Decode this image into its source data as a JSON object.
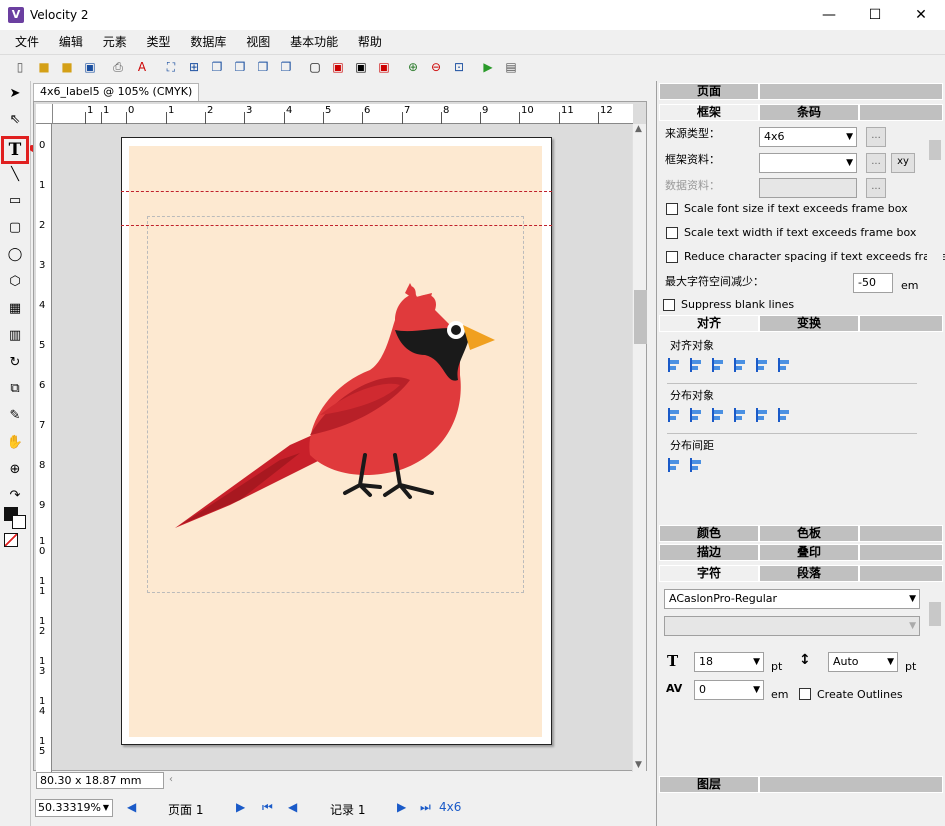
{
  "app": {
    "title": "Velocity 2",
    "icon_letter": "V"
  },
  "window": {
    "minimize": "—",
    "maximize": "☐",
    "close": "✕"
  },
  "menu": [
    "文件",
    "编辑",
    "元素",
    "类型",
    "数据库",
    "视图",
    "基本功能",
    "帮助"
  ],
  "document": {
    "tab": "4x6_label5 @ 105% (CMYK)",
    "size_readout": "80.30 x 18.87 mm"
  },
  "ruler_h": [
    "1",
    "1",
    "0",
    "1",
    "2",
    "3",
    "4",
    "5",
    "6",
    "7",
    "8",
    "9",
    "10",
    "11",
    "12"
  ],
  "ruler_v": [
    "0",
    "1",
    "2",
    "3",
    "4",
    "5",
    "6",
    "7",
    "8",
    "9",
    "1",
    "0",
    "1",
    "1",
    "1",
    "2",
    "1",
    "3",
    "1",
    "4",
    "1",
    "5"
  ],
  "status": {
    "zoom": "50.33319%",
    "page_label": "页面 1",
    "record_label": "记录 1",
    "label_name": "4x6"
  },
  "panel": {
    "page_header": "页面",
    "frame_tabs": [
      "框架",
      "条码"
    ],
    "source_type_label": "来源类型：",
    "source_type_value": "4x6",
    "frame_data_label": "框架资料：",
    "frame_data_value": "",
    "xy_button": "xy",
    "data_source_label": "数据资料：",
    "ellipsis": "...",
    "options": [
      "Scale font size if text exceeds frame box",
      "Scale text width if text exceeds frame box",
      "Reduce character spacing if text exceeds frame"
    ],
    "max_spacing_label": "最大字符空间减少：",
    "max_spacing_value": "-50",
    "max_spacing_unit": "em",
    "suppress_label": "Suppress blank lines",
    "align_tabs": [
      "对齐",
      "变换"
    ],
    "align_objects_label": "对齐对象",
    "distribute_objects_label": "分布对象",
    "distribute_spacing_label": "分布间距",
    "color_tabs": [
      "颜色",
      "色板"
    ],
    "stroke_tabs": [
      "描边",
      "叠印"
    ],
    "char_tabs": [
      "字符",
      "段落"
    ],
    "font_name": "ACaslonPro-Regular",
    "font_style": "",
    "font_size": "18",
    "font_size_unit": "pt",
    "leading": "Auto",
    "leading_unit": "pt",
    "tracking": "0",
    "tracking_unit": "em",
    "create_outlines": "Create Outlines",
    "layers_header": "图层"
  },
  "colors": {
    "label_bg": "#fde9d1",
    "guide_red": "#c0202a",
    "arrow_red": "#e02020",
    "cardinal_red": "#e03a3c"
  }
}
